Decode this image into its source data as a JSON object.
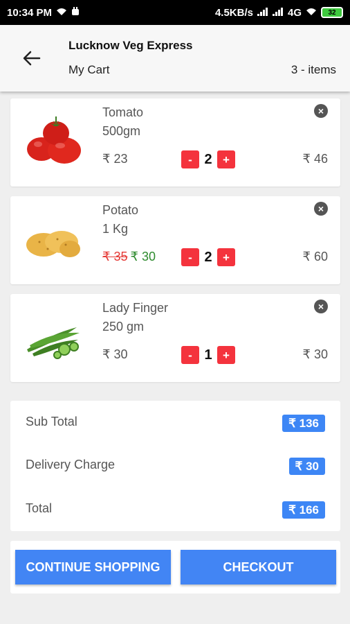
{
  "status_bar": {
    "time": "10:34 PM",
    "network_speed": "4.5KB/s",
    "network_type": "4G",
    "battery": "32"
  },
  "header": {
    "store_name": "Lucknow Veg Express",
    "page_title": "My Cart",
    "items_count": "3 - items"
  },
  "cart_items": [
    {
      "name": "Tomato",
      "quantity_label": "500gm",
      "price": "₹ 23",
      "count": "2",
      "total": "₹ 46",
      "image_icon": "tomato-icon"
    },
    {
      "name": "Potato",
      "quantity_label": "1 Kg",
      "old_price": "₹ 35",
      "price": "₹ 30",
      "count": "2",
      "total": "₹ 60",
      "image_icon": "potato-icon"
    },
    {
      "name": "Lady Finger",
      "quantity_label": "250 gm",
      "price": "₹ 30",
      "count": "1",
      "total": "₹ 30",
      "image_icon": "lady-finger-icon"
    }
  ],
  "stepper": {
    "minus": "-",
    "plus": "+"
  },
  "summary": {
    "sub_total_label": "Sub Total",
    "sub_total": "₹ 136",
    "delivery_label": "Delivery Charge",
    "delivery": "₹ 30",
    "total_label": "Total",
    "total": "₹ 166"
  },
  "actions": {
    "continue_label": "CONTINUE SHOPPING",
    "checkout_label": "CHECKOUT"
  },
  "colors": {
    "accent": "#4285f4",
    "badge": "#3d86f5",
    "stepper": "#f4333d",
    "discount_old": "#e53935",
    "discount_new": "#2e8b2e"
  }
}
